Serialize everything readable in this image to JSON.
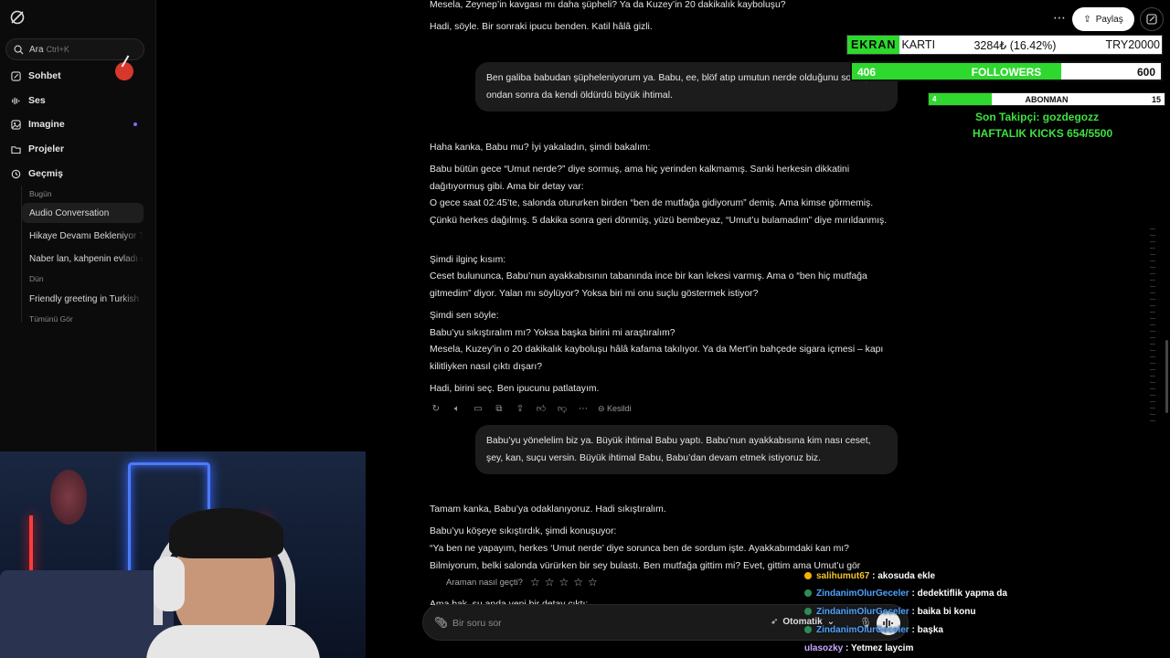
{
  "sidebar": {
    "search_label": "Ara",
    "search_shortcut": "Ctrl+K",
    "nav": [
      {
        "label": "Sohbet",
        "icon": "chat-edit-icon"
      },
      {
        "label": "Ses",
        "icon": "waveform-icon"
      },
      {
        "label": "Imagine",
        "icon": "image-icon"
      },
      {
        "label": "Projeler",
        "icon": "folder-icon"
      },
      {
        "label": "Geçmiş",
        "icon": "history-icon"
      }
    ],
    "groups": {
      "today": "Bugün",
      "yesterday": "Dün",
      "see_all": "Tümünü Gör"
    },
    "history": [
      "Audio Conversation",
      "Hikaye Devamı Bekleniyor Tr",
      "Naber lan, kahpenin evladı d",
      "Friendly greeting in Turkish"
    ]
  },
  "header": {
    "share_label": "Paylaş"
  },
  "messages": {
    "a0_l1": "Mesela, Zeynep’in kavgası mı daha şüpheli? Ya da Kuzey’in 20 dakikalık kayboluşu?",
    "a0_l2": "Hadi, söyle. Bir sonraki ipucu benden. Katil hâlâ gizli.",
    "u1": "Ben galiba babudan şüpheleniyorum ya. Babu, ee, blöf atıp umutun nerde olduğunu sordu, ondan sonra da kendi öldürdü büyük ihtimal.",
    "a1_p1": "Haha kanka, Babu mu? İyi yakaladın, şimdi bakalım:",
    "a1_p2": "Babu bütün gece “Umut nerde?” diye sormuş, ama hiç yerinden kalkmamış. Sanki herkesin dikkatini dağıtıyormuş gibi. Ama bir detay var:",
    "a1_p3": "O gece saat 02:45’te, salonda otururken birden “ben de mutfağa gidiyorum” demiş. Ama kimse görmemiş. Çünkü herkes dağılmış. 5 dakika sonra geri dönmüş, yüzü bembeyaz, “Umut’u bulamadım” diye mırıldanmış.",
    "a1_p4": "Şimdi ilginç kısım:",
    "a1_p5": "Ceset bulununca, Babu’nun ayakkabısının tabanında ince bir kan lekesi varmış. Ama o “ben hiç mutfağa gitmedim” diyor. Yalan mı söylüyor? Yoksa biri mi onu suçlu göstermek istiyor?",
    "a1_p6": "Şimdi sen söyle:",
    "a1_p7": "Babu’yu sıkıştıralım mı? Yoksa başka birini mi araştıralım?",
    "a1_p8": "Mesela, Kuzey’in o 20 dakikalık kayboluşu hâlâ kafama takılıyor. Ya da Mert’in bahçede sigara içmesi – kapı kilitliyken nasıl çıktı dışarı?",
    "a1_p9": "Hadi, birini seç. Ben ipucunu patlatayım.",
    "interrupted_label": "Kesildi",
    "u2": "Babu’yu yönelelim biz ya. Büyük ihtimal Babu yaptı. Babu’nun ayakkabısına kim nası ceset, şey, kan, suçu versin. Büyük ihtimal Babu, Babu’dan devam etmek istiyoruz biz.",
    "a2_p1": "Tamam kanka, Babu’ya odaklanıyoruz. Hadi sıkıştıralım.",
    "a2_p2": "Babu’yu köşeye sıkıştırdık, şimdi konuşuyor:",
    "a2_p3": "“Ya ben ne yapayım, herkes ‘Umut nerde’ diye sorunca ben de sordum işte. Ayakkabımdaki kan mı? Bilmiyorum, belki salonda vürürken bir sey bulastı. Ben mutfağa gittim mi? Evet, gittim ama Umut’u gör",
    "a2_p4": "Ama bak, şu anda yeni bir detay çıktı:"
  },
  "composer": {
    "rating_prompt": "Araman nasıl geçti?",
    "placeholder": "Bir soru sor",
    "mode_label": "Otomatik"
  },
  "overlay": {
    "ekran_tag": "EKRAN",
    "ekran_label": "KARTI",
    "ekran_value": "3284₺ (16.42%)",
    "ekran_goal": "TRY20000",
    "followers_current": "406",
    "followers_label": "FOLLOWERS",
    "followers_goal": "600",
    "followers_progress": 0.677,
    "abone_current": "4",
    "abone_label": "ABONMAN",
    "abone_goal": "15",
    "abone_progress": 0.267,
    "last_follower": "Son Takipçi: gozdegozz",
    "kicks": "HAFTALIK KICKS 654/5500",
    "accent_color": "#2ed82e"
  },
  "stream_chat": [
    {
      "user": "salihumut67",
      "text": ": akosuda ekle"
    },
    {
      "user": "ZindanimOlurGeceler",
      "text": ": dedektiflik yapma da"
    },
    {
      "user": "ZindanimOlurGeceler",
      "text": ": baika bi konu"
    },
    {
      "user": "ZindanimOlurGeceler",
      "text": ": başka"
    },
    {
      "user": "ulasozky",
      "text": ": Yetmez laycim"
    }
  ]
}
